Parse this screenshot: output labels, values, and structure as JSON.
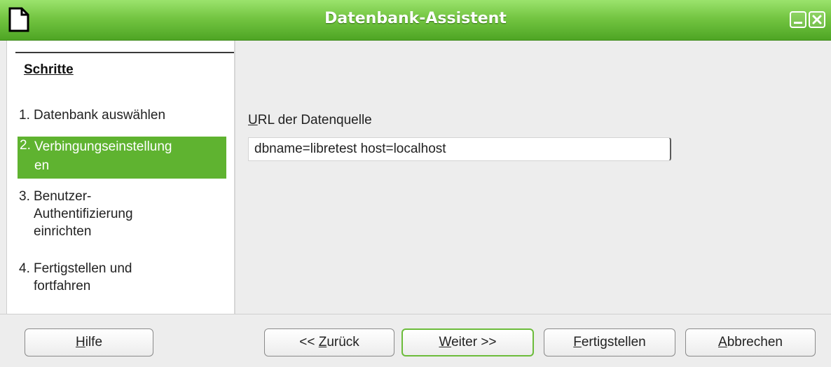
{
  "window": {
    "title": "Datenbank-Assistent",
    "accent_color": "#5fb330"
  },
  "steps": {
    "heading": "Schritte",
    "items": [
      {
        "num": "1.",
        "label": "Datenbank auswählen"
      },
      {
        "num": "2.",
        "label": "Verbingungseinstellungen",
        "line1": "Verbingungseinstellung",
        "line2": "en",
        "active": true
      },
      {
        "num": "3.",
        "line1": "Benutzer-",
        "line2": "Authentifizierung",
        "line3": "einrichten"
      },
      {
        "num": "4.",
        "line1": "Fertigstellen und",
        "line2": "fortfahren"
      }
    ]
  },
  "form": {
    "url_label_mnemonic": "U",
    "url_label_rest": "RL der Datenquelle",
    "url_value": "dbname=libretest host=localhost"
  },
  "buttons": {
    "help": {
      "mn": "H",
      "rest": "ilfe"
    },
    "back": {
      "pre": "<< ",
      "mn": "Z",
      "rest": "urück"
    },
    "next": {
      "mn": "W",
      "rest": "eiter >>"
    },
    "finish": {
      "mn": "F",
      "rest": "ertigstellen"
    },
    "cancel": {
      "mn": "A",
      "rest": "bbrechen"
    }
  },
  "icons": {
    "app": "document-icon",
    "minimize": "minimize-icon",
    "close": "close-icon"
  }
}
